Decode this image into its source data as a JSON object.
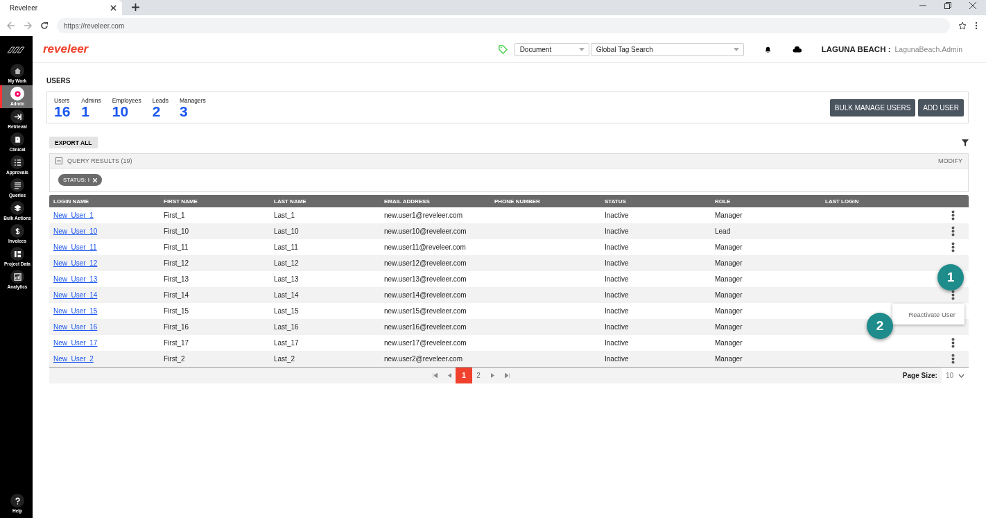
{
  "browser": {
    "tab_title": "Reveleer",
    "url": "https://reveleer.com"
  },
  "sidebar": {
    "items": [
      {
        "label": "My Work",
        "selected": false
      },
      {
        "label": "Admin",
        "selected": true
      },
      {
        "label": "Retrieval",
        "selected": false
      },
      {
        "label": "Clinical",
        "selected": false
      },
      {
        "label": "Approvals",
        "selected": false
      },
      {
        "label": "Queries",
        "selected": false
      },
      {
        "label": "Bulk Actions",
        "selected": false
      },
      {
        "label": "Invoices",
        "selected": false
      },
      {
        "label": "Project Data",
        "selected": false
      },
      {
        "label": "Analytics",
        "selected": false
      }
    ],
    "help": "Help"
  },
  "header": {
    "logo": "reveleer",
    "document_select": "Document",
    "tag_search": "Global Tag Search",
    "org": "LAGUNA BEACH :",
    "user": "LagunaBeach.Admin"
  },
  "page_title": "USERS",
  "stats": [
    {
      "label": "Users",
      "value": "16"
    },
    {
      "label": "Admins",
      "value": "1"
    },
    {
      "label": "Employees",
      "value": "10"
    },
    {
      "label": "Leads",
      "value": "2"
    },
    {
      "label": "Managers",
      "value": "3"
    }
  ],
  "buttons": [
    "BULK MANAGE USERS",
    "ADD USER"
  ],
  "export_button": "EXPORT ALL",
  "query": {
    "title": "QUERY RESULTS (19)",
    "modify": "MODIFY",
    "expanded": true,
    "filters": [
      "STATUS: I"
    ]
  },
  "table": {
    "columns": [
      "LOGIN NAME",
      "FIRST NAME",
      "LAST NAME",
      "EMAIL ADDRESS",
      "PHONE NUMBER",
      "STATUS",
      "ROLE",
      "LAST LOGIN"
    ],
    "rows": [
      {
        "login": "New_User_1",
        "first": "First_1",
        "last": "Last_1",
        "email": "new.user1@reveleer.com",
        "status": "Inactive",
        "role": "Manager",
        "menu_icon": true,
        "menu_open": false
      },
      {
        "login": "New_User_10",
        "first": "First_10",
        "last": "Last_10",
        "email": "new.user10@reveleer.com",
        "status": "Inactive",
        "role": "Lead",
        "menu_icon": true,
        "menu_open": false
      },
      {
        "login": "New_User_11",
        "first": "First_11",
        "last": "Last_11",
        "email": "new.user11@reveleer.com",
        "status": "Inactive",
        "role": "Manager",
        "menu_icon": true,
        "menu_open": false
      },
      {
        "login": "New_User_12",
        "first": "First_12",
        "last": "Last_12",
        "email": "new.user12@reveleer.com",
        "status": "Inactive",
        "role": "Manager",
        "menu_icon": false,
        "menu_open": false
      },
      {
        "login": "New_User_13",
        "first": "First_13",
        "last": "Last_13",
        "email": "new.user13@reveleer.com",
        "status": "Inactive",
        "role": "Manager",
        "menu_icon": false,
        "menu_open": false
      },
      {
        "login": "New_User_14",
        "first": "First_14",
        "last": "Last_14",
        "email": "new.user14@reveleer.com",
        "status": "Inactive",
        "role": "Manager",
        "menu_icon": true,
        "menu_open": true
      },
      {
        "login": "New_User_15",
        "first": "First_15",
        "last": "Last_15",
        "email": "new.user15@reveleer.com",
        "status": "Inactive",
        "role": "Manager",
        "menu_icon": false,
        "menu_open": false
      },
      {
        "login": "New_User_16",
        "first": "First_16",
        "last": "Last_16",
        "email": "new.user16@reveleer.com",
        "status": "Inactive",
        "role": "Manager",
        "menu_icon": false,
        "menu_open": false
      },
      {
        "login": "New_User_17",
        "first": "First_17",
        "last": "Last_17",
        "email": "new.user17@reveleer.com",
        "status": "Inactive",
        "role": "Manager",
        "menu_icon": true,
        "menu_open": false
      },
      {
        "login": "New_User_2",
        "first": "First_2",
        "last": "Last_2",
        "email": "new.user2@reveleer.com",
        "status": "Inactive",
        "role": "Manager",
        "menu_icon": true,
        "menu_open": false
      }
    ],
    "menu_items": [
      "Reactivate User"
    ]
  },
  "pagination": {
    "pages": [
      {
        "label": "1",
        "selected": true
      },
      {
        "label": "2",
        "selected": false
      }
    ],
    "page_size_label": "Page Size:",
    "page_size": "10"
  },
  "callouts": [
    "1",
    "2"
  ]
}
